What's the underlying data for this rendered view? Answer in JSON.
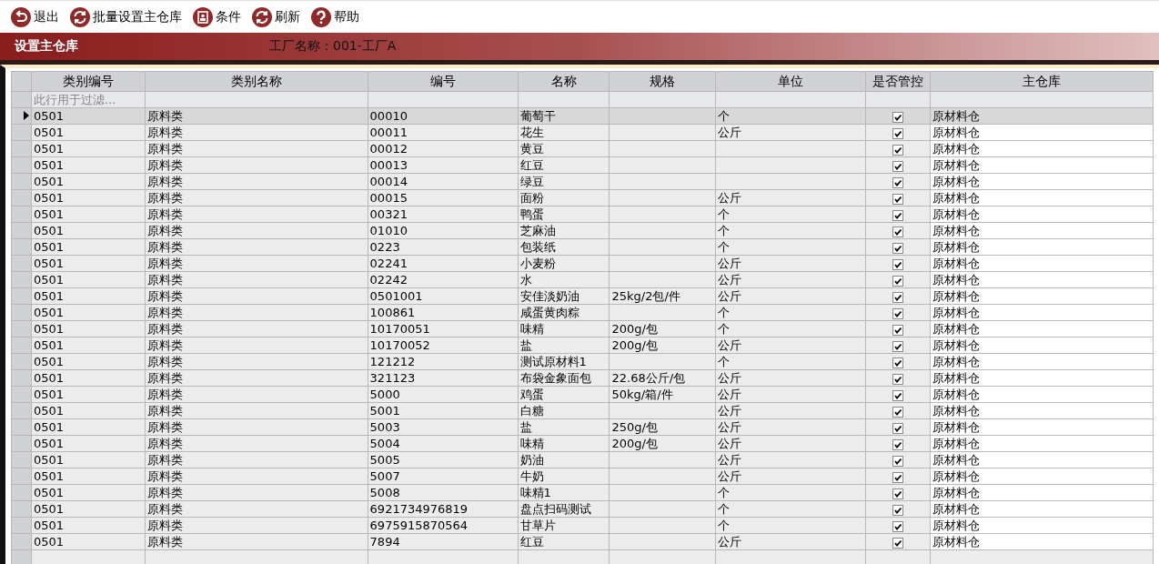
{
  "toolbar": [
    {
      "kind": "back",
      "label": "退出"
    },
    {
      "kind": "refresh",
      "label": "批量设置主仓库"
    },
    {
      "kind": "card",
      "label": "条件"
    },
    {
      "kind": "refresh",
      "label": "刷新"
    },
    {
      "kind": "help",
      "label": "帮助"
    }
  ],
  "title_bar": {
    "title": "设置主仓库",
    "factory": "工厂名称：001-工厂A"
  },
  "table": {
    "columns": [
      "类别编号",
      "类别名称",
      "编号",
      "名称",
      "规格",
      "单位",
      "是否管控",
      "主仓库"
    ],
    "filter_placeholder": "此行用于过滤...",
    "rows": [
      {
        "selected": true,
        "category_code": "0501",
        "category_name": "原料类",
        "code": "00010",
        "name": "葡萄干",
        "unit": "个",
        "managed": true,
        "warehouse": "原材料仓"
      },
      {
        "selected": false,
        "category_code": "0501",
        "category_name": "原料类",
        "code": "00011",
        "name": "花生",
        "unit": "公斤",
        "managed": true,
        "warehouse": "原材料仓"
      },
      {
        "selected": false,
        "category_code": "0501",
        "category_name": "原料类",
        "code": "00012",
        "name": "黄豆",
        "managed": true,
        "warehouse": "原材料仓"
      },
      {
        "selected": false,
        "category_code": "0501",
        "category_name": "原料类",
        "code": "00013",
        "name": "红豆",
        "managed": true,
        "warehouse": "原材料仓"
      },
      {
        "selected": false,
        "category_code": "0501",
        "category_name": "原料类",
        "code": "00014",
        "name": "绿豆",
        "managed": true,
        "warehouse": "原材料仓"
      },
      {
        "selected": false,
        "category_code": "0501",
        "category_name": "原料类",
        "code": "00015",
        "name": "面粉",
        "unit": "公斤",
        "managed": true,
        "warehouse": "原材料仓"
      },
      {
        "selected": false,
        "category_code": "0501",
        "category_name": "原料类",
        "code": "00321",
        "name": "鸭蛋",
        "unit": "个",
        "managed": true,
        "warehouse": "原材料仓"
      },
      {
        "selected": false,
        "category_code": "0501",
        "category_name": "原料类",
        "code": "01010",
        "name": "芝麻油",
        "unit": "个",
        "managed": true,
        "warehouse": "原材料仓"
      },
      {
        "selected": false,
        "category_code": "0501",
        "category_name": "原料类",
        "code": "0223",
        "name": "包装纸",
        "unit": "个",
        "managed": true,
        "warehouse": "原材料仓"
      },
      {
        "selected": false,
        "category_code": "0501",
        "category_name": "原料类",
        "code": "02241",
        "name": "小麦粉",
        "unit": "公斤",
        "managed": true,
        "warehouse": "原材料仓"
      },
      {
        "selected": false,
        "category_code": "0501",
        "category_name": "原料类",
        "code": "02242",
        "name": "水",
        "unit": "公斤",
        "managed": true,
        "warehouse": "原材料仓"
      },
      {
        "selected": false,
        "category_code": "0501",
        "category_name": "原料类",
        "code": "0501001",
        "name": "安佳淡奶油",
        "spec": "25kg/2包/件",
        "unit": "公斤",
        "managed": true,
        "warehouse": "原材料仓"
      },
      {
        "selected": false,
        "category_code": "0501",
        "category_name": "原料类",
        "code": "100861",
        "name": "咸蛋黄肉粽",
        "unit": "个",
        "managed": true,
        "warehouse": "原材料仓"
      },
      {
        "selected": false,
        "category_code": "0501",
        "category_name": "原料类",
        "code": "10170051",
        "name": "味精",
        "spec": "200g/包",
        "unit": "个",
        "managed": true,
        "warehouse": "原材料仓"
      },
      {
        "selected": false,
        "category_code": "0501",
        "category_name": "原料类",
        "code": "10170052",
        "name": "盐",
        "spec": "200g/包",
        "unit": "公斤",
        "managed": true,
        "warehouse": "原材料仓"
      },
      {
        "selected": false,
        "category_code": "0501",
        "category_name": "原料类",
        "code": "121212",
        "name": "测试原材料1",
        "unit": "个",
        "managed": true,
        "warehouse": "原材料仓"
      },
      {
        "selected": false,
        "category_code": "0501",
        "category_name": "原料类",
        "code": "321123",
        "name": "布袋金象面包",
        "spec": "22.68公斤/包",
        "unit": "公斤",
        "managed": true,
        "warehouse": "原材料仓"
      },
      {
        "selected": false,
        "category_code": "0501",
        "category_name": "原料类",
        "code": "5000",
        "name": "鸡蛋",
        "spec": "50kg/箱/件",
        "unit": "公斤",
        "managed": true,
        "warehouse": "原材料仓"
      },
      {
        "selected": false,
        "category_code": "0501",
        "category_name": "原料类",
        "code": "5001",
        "name": "白糖",
        "unit": "公斤",
        "managed": true,
        "warehouse": "原材料仓"
      },
      {
        "selected": false,
        "category_code": "0501",
        "category_name": "原料类",
        "code": "5003",
        "name": "盐",
        "spec": "250g/包",
        "unit": "公斤",
        "managed": true,
        "warehouse": "原材料仓"
      },
      {
        "selected": false,
        "category_code": "0501",
        "category_name": "原料类",
        "code": "5004",
        "name": "味精",
        "spec": "200g/包",
        "unit": "公斤",
        "managed": true,
        "warehouse": "原材料仓"
      },
      {
        "selected": false,
        "category_code": "0501",
        "category_name": "原料类",
        "code": "5005",
        "name": "奶油",
        "unit": "公斤",
        "managed": true,
        "warehouse": "原材料仓"
      },
      {
        "selected": false,
        "category_code": "0501",
        "category_name": "原料类",
        "code": "5007",
        "name": "牛奶",
        "unit": "公斤",
        "managed": true,
        "warehouse": "原材料仓"
      },
      {
        "selected": false,
        "category_code": "0501",
        "category_name": "原料类",
        "code": "5008",
        "name": "味精1",
        "unit": "个",
        "managed": true,
        "warehouse": "原材料仓"
      },
      {
        "selected": false,
        "category_code": "0501",
        "category_name": "原料类",
        "code": "6921734976819",
        "name": "盘点扫码测试",
        "unit": "个",
        "managed": true,
        "warehouse": "原材料仓"
      },
      {
        "selected": false,
        "category_code": "0501",
        "category_name": "原料类",
        "code": "6975915870564",
        "name": "甘草片",
        "unit": "个",
        "managed": true,
        "warehouse": "原材料仓"
      },
      {
        "selected": false,
        "category_code": "0501",
        "category_name": "原料类",
        "code": "7894",
        "name": "红豆",
        "unit": "公斤",
        "managed": true,
        "warehouse": "原材料仓"
      }
    ]
  }
}
